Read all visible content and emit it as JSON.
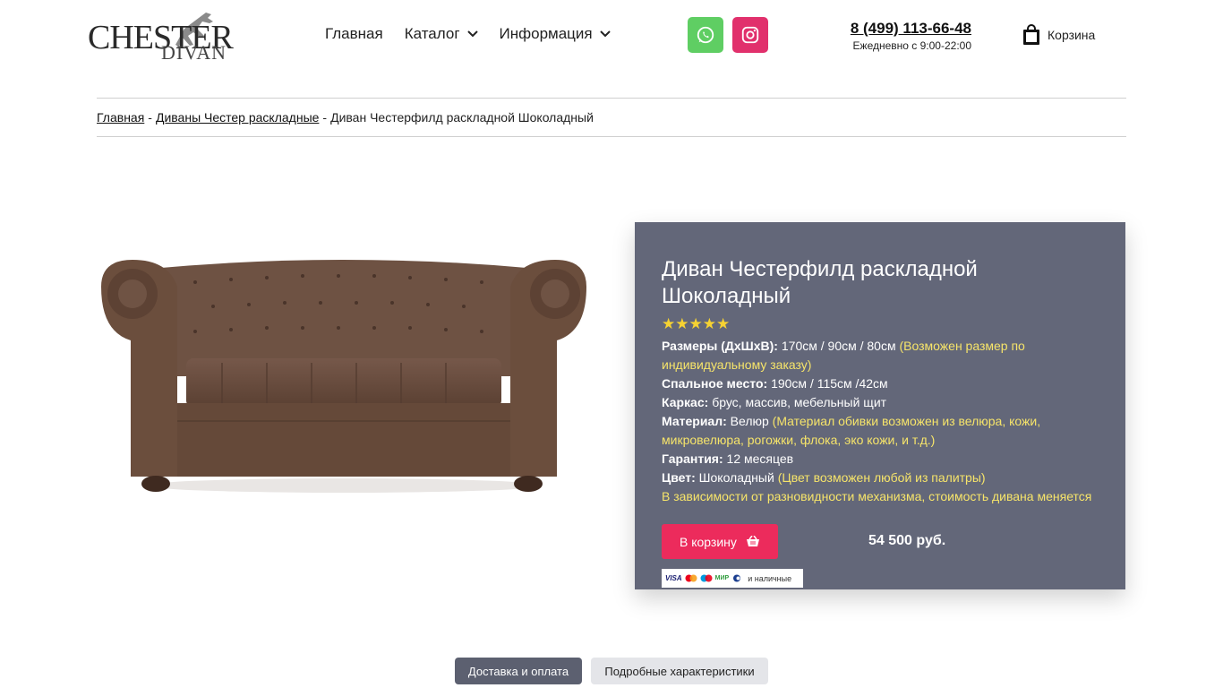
{
  "brand": {
    "logo_line1": "CHESTER",
    "logo_line2": "DIVAN"
  },
  "nav": {
    "home": "Главная",
    "catalog": "Каталог",
    "info": "Информация"
  },
  "social": {
    "whatsapp_icon": "whatsapp-icon",
    "instagram_icon": "instagram-icon"
  },
  "contact": {
    "phone": "8 (499) 113-66-48",
    "hours": "Ежедневно с 9:00-22:00"
  },
  "cart": {
    "label": "Корзина"
  },
  "breadcrumb": {
    "home": "Главная",
    "sep1": "-",
    "category": "Диваны Честер раскладные",
    "sep2": "-",
    "current": "Диван Честерфилд раскладной Шоколадный"
  },
  "product": {
    "title": "Диван Честерфилд раскладной Шоколадный",
    "stars": "★★★★★",
    "specs": {
      "size_label": "Размеры (ДхШхВ):",
      "size_value": "170см / 90см / 80см",
      "size_note": "(Возможен размер по индивидуальному заказу)",
      "sleep_label": "Спальное место:",
      "sleep_value": "190см / 115см /42см",
      "frame_label": "Каркас:",
      "frame_value": "брус, массив, мебельный щит",
      "material_label": "Материал:",
      "material_value": "Велюр",
      "material_note": "(Материал обивки возможен из велюра, кожи, микровелюра, рогожки, флока, эко кожи, и т.д.)",
      "warranty_label": "Гарантия:",
      "warranty_value": "12 месяцев",
      "color_label": "Цвет:",
      "color_value": "Шоколадный",
      "color_note": "(Цвет возможен любой из палитры)",
      "mechanism_note": "В зависимости от разновидности механизма, стоимость дивана меняется"
    },
    "buy_label": "В корзину",
    "price": "54 500 руб.",
    "payment": {
      "visa": "VISA",
      "mir": "МИР",
      "cash": "и наличные"
    }
  },
  "tabs": [
    {
      "label": "Доставка и оплата",
      "active": true
    },
    {
      "label": "Подробные характеристики",
      "active": false
    }
  ],
  "colors": {
    "panel_bg": "#636779",
    "accent_pink": "#ec2b5c",
    "highlight_yellow": "#f6e46a",
    "whatsapp_green": "#5fce63",
    "instagram_pink": "#e1306c",
    "sofa_brown": "#6b4e3d"
  }
}
